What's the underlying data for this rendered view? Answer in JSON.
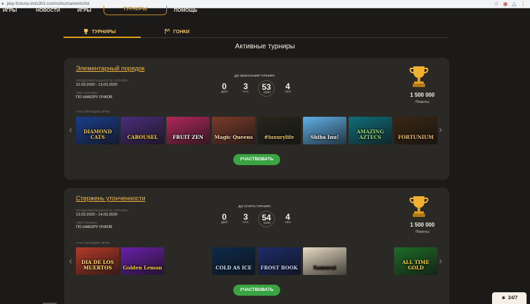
{
  "browser": {
    "url": "play-fortuna-slots3h3.com/ru/tournaments/list",
    "icons": [
      "star-icon",
      "extension-icon",
      "profile-icon",
      "menu-icon"
    ]
  },
  "topnav": {
    "items": [
      "ИГРЫ",
      "НОВОСТИ",
      "ИГРЫ",
      "ТУРНИРЫ",
      "ПОМОЩЬ"
    ],
    "active": "ТУРНИРЫ"
  },
  "tabs": [
    {
      "label": "ТУРНИРЫ",
      "icon": "trophy-icon"
    },
    {
      "label": "ГОНКИ",
      "icon": "race-flag-icon"
    }
  ],
  "section_title": "Активные турниры",
  "tournaments": [
    {
      "title": "Элементарный порядок",
      "duration_label": "ПРОДОЛЖИТЕЛЬНОСТЬ ТУРНИРА",
      "duration": "12.03.2020 - 13.03.2020",
      "type_label": "ТИП ТУРНИРА",
      "type": "ПО НАБОРУ ОЧКОВ",
      "timer_label": "ДО ОКОНЧАНИЯ ТУРНИРА",
      "timer": [
        {
          "value": "0",
          "unit": "ДЕЙ"
        },
        {
          "value": "3",
          "unit": "ЧАС"
        },
        {
          "value": "53",
          "unit": "МИН"
        },
        {
          "value": "4",
          "unit": "СЕК"
        }
      ],
      "prize": "1 500 000",
      "prize_unit": "Поинты",
      "games_label": "УЧАСТВУЮЩИЕ ИГРЫ",
      "games": [
        {
          "name": "DIAMOND CATS",
          "color": "#1b3d8a",
          "accent": "#f2c94c"
        },
        {
          "name": "CAROUSEL",
          "color": "#4a2d7a",
          "accent": "#ffd24a"
        },
        {
          "name": "FRUIT ZEN",
          "color": "#b0285a",
          "accent": "#ffffff"
        },
        {
          "name": "Magic Queens",
          "color": "#7a3b2a",
          "accent": "#ffe0b0"
        },
        {
          "name": "#luxurylife",
          "color": "#26261c",
          "accent": "#e6c770"
        },
        {
          "name": "Shiba Inu!",
          "color": "#5fb0e6",
          "accent": "#ffffff"
        },
        {
          "name": "AMAZING AZTECS",
          "color": "#0f6e7a",
          "accent": "#9be27a"
        },
        {
          "name": "FORTUNIUM",
          "color": "#3a2614",
          "accent": "#f5c36a"
        }
      ],
      "join": "УЧАСТВОВАТЬ"
    },
    {
      "title": "Стержень утонченности",
      "duration_label": "ПРОДОЛЖИТЕЛЬНОСТЬ ТУРНИРА",
      "duration": "13.03.2020 - 14.03.2020",
      "type_label": "ТИП ТУРНИРА",
      "type": "ПО НАБОРУ ОЧКОВ",
      "timer_label": "ДО СТАРТА ТУРНИРА",
      "timer": [
        {
          "value": "0",
          "unit": "ДЕЙ"
        },
        {
          "value": "3",
          "unit": "ЧАС"
        },
        {
          "value": "54",
          "unit": "МИН"
        },
        {
          "value": "4",
          "unit": "СЕК"
        }
      ],
      "prize": "1 500 000",
      "prize_unit": "Поинты",
      "games_label": "УЧАСТВУЮЩИЕ ИГРЫ",
      "games": [
        {
          "name": "DIA DE LOS MUERTOS",
          "color": "#b33a28",
          "accent": "#ffe070"
        },
        {
          "name": "Golden Lemon",
          "color": "#6a1fa8",
          "accent": "#ffd23a"
        },
        {
          "name": "COLD AS ICE",
          "color": "#0c2a4a",
          "accent": "#cfe8ff"
        },
        {
          "name": "FROST BOOK",
          "color": "#1c2c6a",
          "accent": "#c9d6ff"
        },
        {
          "name": "Samurai",
          "color": "#e8dcc4",
          "accent": "#2a1a10"
        },
        {
          "name": "ALL TIME GOLD",
          "color": "#1e6a28",
          "accent": "#ffd23a"
        }
      ],
      "join": "УЧАСТВОВАТЬ"
    }
  ],
  "chat": {
    "label": "24/7",
    "icon": "chat-icon"
  }
}
